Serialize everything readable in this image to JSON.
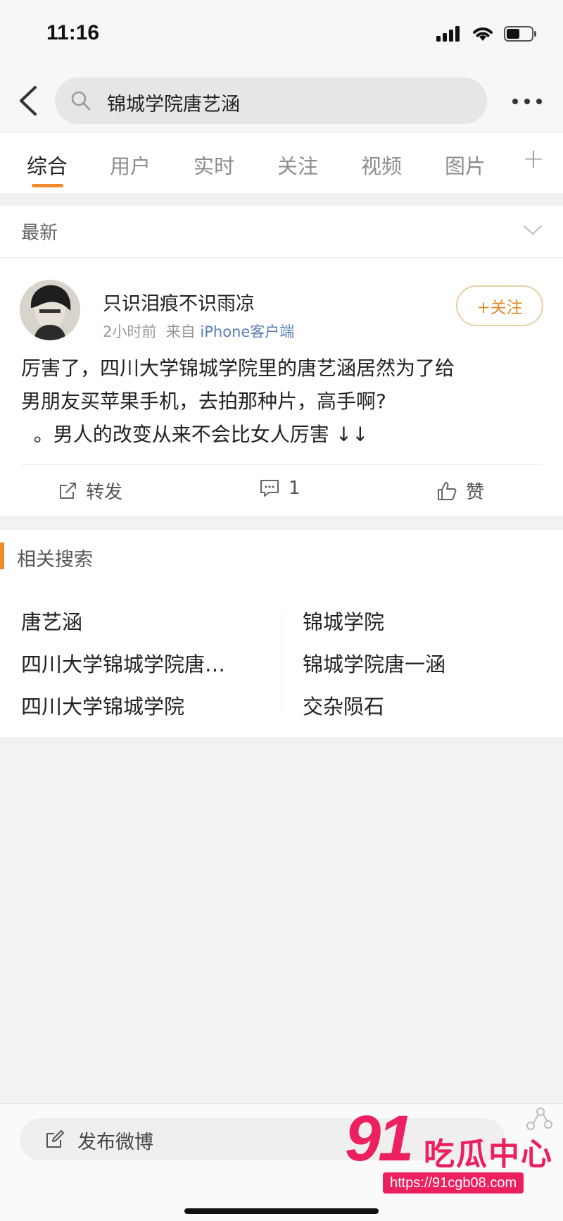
{
  "status_bar": {
    "time": "11:16"
  },
  "search": {
    "query": "锦城学院唐艺涵"
  },
  "tabs": [
    {
      "label": "综合",
      "active": true
    },
    {
      "label": "用户"
    },
    {
      "label": "实时"
    },
    {
      "label": "关注"
    },
    {
      "label": "视频"
    },
    {
      "label": "图片"
    }
  ],
  "tabs_more": "+",
  "filter": {
    "label": "最新"
  },
  "post": {
    "username": "只识泪痕不识雨凉",
    "time": "2小时前",
    "source_prefix": "来自",
    "source": "iPhone客户端",
    "follow_label": "+关注",
    "lines": [
      "厉害了，四川大学锦城学院里的唐艺涵居然为了给",
      "男朋友买苹果手机，去拍那种片，高手啊?",
      "  。男人的改变从来不会比女人厉害 ↓↓"
    ],
    "actions": {
      "repost": "转发",
      "comment_count": "1",
      "like": "赞"
    }
  },
  "related": {
    "title": "相关搜索",
    "left": [
      "唐艺涵",
      "四川大学锦城学院唐…",
      "四川大学锦城学院"
    ],
    "right": [
      "锦城学院",
      "锦城学院唐一涵",
      "交杂陨石"
    ]
  },
  "compose": {
    "label": "发布微博"
  },
  "watermark": {
    "number": "91",
    "text": "吃瓜中心",
    "url": "https://91cgb08.com"
  },
  "colors": {
    "accent": "#f08a2c",
    "link": "#5b7fb3",
    "watermark": "#ec1f5f"
  }
}
